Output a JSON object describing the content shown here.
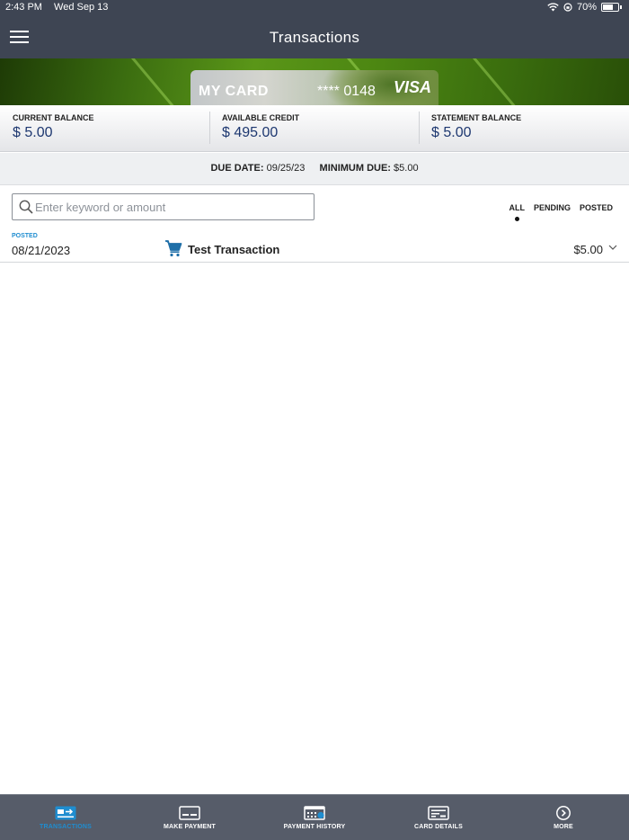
{
  "status_bar": {
    "time": "2:43 PM",
    "date": "Wed Sep 13",
    "battery": "70%",
    "battery_level": 0.7
  },
  "header": {
    "title": "Transactions"
  },
  "card": {
    "name": "MY CARD",
    "number": "**** 0148",
    "brand": "VISA"
  },
  "balances": [
    {
      "label": "CURRENT BALANCE",
      "value": "$ 5.00"
    },
    {
      "label": "AVAILABLE CREDIT",
      "value": "$ 495.00"
    },
    {
      "label": "STATEMENT BALANCE",
      "value": "$ 5.00"
    }
  ],
  "due": {
    "due_label": "DUE DATE:",
    "due_value": "09/25/23",
    "min_label": "MINIMUM DUE:",
    "min_value": "$5.00"
  },
  "search": {
    "placeholder": "Enter keyword or amount",
    "value": ""
  },
  "filters": [
    {
      "label": "ALL",
      "active": true
    },
    {
      "label": "PENDING",
      "active": false
    },
    {
      "label": "POSTED",
      "active": false
    }
  ],
  "transactions": [
    {
      "status": "POSTED",
      "date": "08/21/2023",
      "description": "Test Transaction",
      "amount": "$5.00",
      "icon": "cart-icon"
    }
  ],
  "tabs": [
    {
      "label": "TRANSACTIONS",
      "icon": "transactions-icon",
      "active": true
    },
    {
      "label": "MAKE PAYMENT",
      "icon": "make-payment-icon",
      "active": false
    },
    {
      "label": "PAYMENT HISTORY",
      "icon": "payment-history-icon",
      "active": false
    },
    {
      "label": "CARD DETAILS",
      "icon": "card-details-icon",
      "active": false
    },
    {
      "label": "MORE",
      "icon": "more-icon",
      "active": false
    }
  ],
  "colors": {
    "nav": "#3e4553",
    "accent": "#1f8dd0",
    "balance_value": "#1d3770",
    "tab_bar": "#565c69"
  }
}
